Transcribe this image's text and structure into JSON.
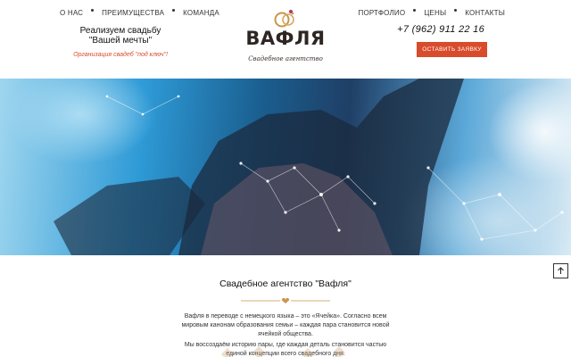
{
  "header": {
    "nav_left": [
      "О НАС",
      "ПРЕИМУЩЕСТВА",
      "КОМАНДА"
    ],
    "nav_right": [
      "ПОРТФОЛИО",
      "ЦЕНЫ",
      "КОНТАКТЫ"
    ],
    "tagline_line1": "Реализуем свадьбу",
    "tagline_line2": "\"Вашей мечты\"",
    "tagline_sub": "Организация свадеб \"под ключ\"!",
    "logo_name": "ВАФЛЯ",
    "logo_sub": "Свадебное агентство",
    "phone": "+7 (962) 911 22 16",
    "cta_label": "ОСТАВИТЬ ЗАЯВКУ"
  },
  "about": {
    "title": "Свадебное агентство \"Вафля\"",
    "para1": "Вафля в переводе с немецкого языка – это «Ячейка». Согласно всем мировым канонам образования семьи – каждая пара становится новой ячейкой общества.",
    "para2": "Мы воссоздаём историю пары, где каждая деталь становится частью единой концепции всего свадебного дня."
  },
  "icons": {
    "logo": "rings-icon",
    "scroll_top": "arrow-up-icon",
    "divider": "heart-divider-icon"
  },
  "colors": {
    "accent": "#d84b2b",
    "logo_gold": "#c9964a",
    "text_dark": "#222222"
  }
}
